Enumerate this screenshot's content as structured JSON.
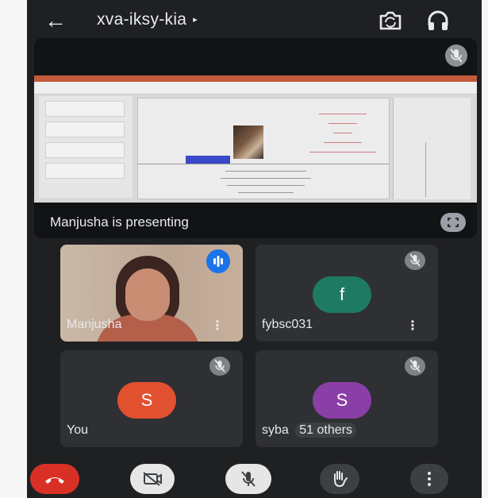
{
  "header": {
    "back_icon": "arrow-left-icon",
    "meeting_code": "xva-iksy-kia",
    "meeting_caret": "▸",
    "switch_camera_icon": "camera-switch-icon",
    "audio_icon": "headphones-icon"
  },
  "presentation": {
    "label": "Manjusha is presenting",
    "mute_icon": "mic-off-icon",
    "fullscreen_icon": "fullscreen-icon"
  },
  "tiles": [
    {
      "name": "Manjusha",
      "more": "⋮",
      "status_icon": "speaking-icon",
      "type": "video"
    },
    {
      "name": "fybsc031",
      "more": "⋮",
      "avatar_letter": "f",
      "avatar_color": "#1e7a63",
      "status_icon": "mic-off-icon"
    },
    {
      "name": "You",
      "avatar_letter": "S",
      "avatar_color": "#e1502f",
      "status_icon": "mic-off-icon"
    },
    {
      "name": "syba",
      "others": "51 others",
      "avatar_letter": "S",
      "avatar_color": "#8a3fa6",
      "status_icon": "mic-off-icon"
    }
  ],
  "controls": {
    "end_call_icon": "end-call-icon",
    "camera_icon": "camera-off-icon",
    "mic_icon": "mic-off-icon",
    "raise_hand_icon": "raise-hand-icon",
    "more_icon": "more-vertical-icon"
  },
  "colors": {
    "background": "#1f2022",
    "tile": "#2e3033",
    "end_call": "#d93025",
    "speaking": "#1a73e8"
  }
}
